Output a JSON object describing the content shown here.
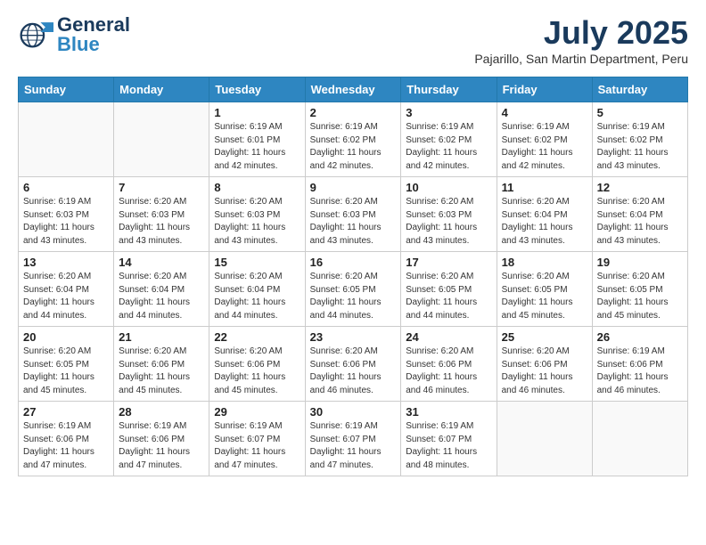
{
  "header": {
    "logo_general": "General",
    "logo_blue": "Blue",
    "month": "July 2025",
    "location": "Pajarillo, San Martin Department, Peru"
  },
  "calendar": {
    "days_of_week": [
      "Sunday",
      "Monday",
      "Tuesday",
      "Wednesday",
      "Thursday",
      "Friday",
      "Saturday"
    ],
    "weeks": [
      [
        {
          "day": "",
          "detail": ""
        },
        {
          "day": "",
          "detail": ""
        },
        {
          "day": "1",
          "detail": "Sunrise: 6:19 AM\nSunset: 6:01 PM\nDaylight: 11 hours\nand 42 minutes."
        },
        {
          "day": "2",
          "detail": "Sunrise: 6:19 AM\nSunset: 6:02 PM\nDaylight: 11 hours\nand 42 minutes."
        },
        {
          "day": "3",
          "detail": "Sunrise: 6:19 AM\nSunset: 6:02 PM\nDaylight: 11 hours\nand 42 minutes."
        },
        {
          "day": "4",
          "detail": "Sunrise: 6:19 AM\nSunset: 6:02 PM\nDaylight: 11 hours\nand 42 minutes."
        },
        {
          "day": "5",
          "detail": "Sunrise: 6:19 AM\nSunset: 6:02 PM\nDaylight: 11 hours\nand 43 minutes."
        }
      ],
      [
        {
          "day": "6",
          "detail": "Sunrise: 6:19 AM\nSunset: 6:03 PM\nDaylight: 11 hours\nand 43 minutes."
        },
        {
          "day": "7",
          "detail": "Sunrise: 6:20 AM\nSunset: 6:03 PM\nDaylight: 11 hours\nand 43 minutes."
        },
        {
          "day": "8",
          "detail": "Sunrise: 6:20 AM\nSunset: 6:03 PM\nDaylight: 11 hours\nand 43 minutes."
        },
        {
          "day": "9",
          "detail": "Sunrise: 6:20 AM\nSunset: 6:03 PM\nDaylight: 11 hours\nand 43 minutes."
        },
        {
          "day": "10",
          "detail": "Sunrise: 6:20 AM\nSunset: 6:03 PM\nDaylight: 11 hours\nand 43 minutes."
        },
        {
          "day": "11",
          "detail": "Sunrise: 6:20 AM\nSunset: 6:04 PM\nDaylight: 11 hours\nand 43 minutes."
        },
        {
          "day": "12",
          "detail": "Sunrise: 6:20 AM\nSunset: 6:04 PM\nDaylight: 11 hours\nand 43 minutes."
        }
      ],
      [
        {
          "day": "13",
          "detail": "Sunrise: 6:20 AM\nSunset: 6:04 PM\nDaylight: 11 hours\nand 44 minutes."
        },
        {
          "day": "14",
          "detail": "Sunrise: 6:20 AM\nSunset: 6:04 PM\nDaylight: 11 hours\nand 44 minutes."
        },
        {
          "day": "15",
          "detail": "Sunrise: 6:20 AM\nSunset: 6:04 PM\nDaylight: 11 hours\nand 44 minutes."
        },
        {
          "day": "16",
          "detail": "Sunrise: 6:20 AM\nSunset: 6:05 PM\nDaylight: 11 hours\nand 44 minutes."
        },
        {
          "day": "17",
          "detail": "Sunrise: 6:20 AM\nSunset: 6:05 PM\nDaylight: 11 hours\nand 44 minutes."
        },
        {
          "day": "18",
          "detail": "Sunrise: 6:20 AM\nSunset: 6:05 PM\nDaylight: 11 hours\nand 45 minutes."
        },
        {
          "day": "19",
          "detail": "Sunrise: 6:20 AM\nSunset: 6:05 PM\nDaylight: 11 hours\nand 45 minutes."
        }
      ],
      [
        {
          "day": "20",
          "detail": "Sunrise: 6:20 AM\nSunset: 6:05 PM\nDaylight: 11 hours\nand 45 minutes."
        },
        {
          "day": "21",
          "detail": "Sunrise: 6:20 AM\nSunset: 6:06 PM\nDaylight: 11 hours\nand 45 minutes."
        },
        {
          "day": "22",
          "detail": "Sunrise: 6:20 AM\nSunset: 6:06 PM\nDaylight: 11 hours\nand 45 minutes."
        },
        {
          "day": "23",
          "detail": "Sunrise: 6:20 AM\nSunset: 6:06 PM\nDaylight: 11 hours\nand 46 minutes."
        },
        {
          "day": "24",
          "detail": "Sunrise: 6:20 AM\nSunset: 6:06 PM\nDaylight: 11 hours\nand 46 minutes."
        },
        {
          "day": "25",
          "detail": "Sunrise: 6:20 AM\nSunset: 6:06 PM\nDaylight: 11 hours\nand 46 minutes."
        },
        {
          "day": "26",
          "detail": "Sunrise: 6:19 AM\nSunset: 6:06 PM\nDaylight: 11 hours\nand 46 minutes."
        }
      ],
      [
        {
          "day": "27",
          "detail": "Sunrise: 6:19 AM\nSunset: 6:06 PM\nDaylight: 11 hours\nand 47 minutes."
        },
        {
          "day": "28",
          "detail": "Sunrise: 6:19 AM\nSunset: 6:06 PM\nDaylight: 11 hours\nand 47 minutes."
        },
        {
          "day": "29",
          "detail": "Sunrise: 6:19 AM\nSunset: 6:07 PM\nDaylight: 11 hours\nand 47 minutes."
        },
        {
          "day": "30",
          "detail": "Sunrise: 6:19 AM\nSunset: 6:07 PM\nDaylight: 11 hours\nand 47 minutes."
        },
        {
          "day": "31",
          "detail": "Sunrise: 6:19 AM\nSunset: 6:07 PM\nDaylight: 11 hours\nand 48 minutes."
        },
        {
          "day": "",
          "detail": ""
        },
        {
          "day": "",
          "detail": ""
        }
      ]
    ]
  }
}
